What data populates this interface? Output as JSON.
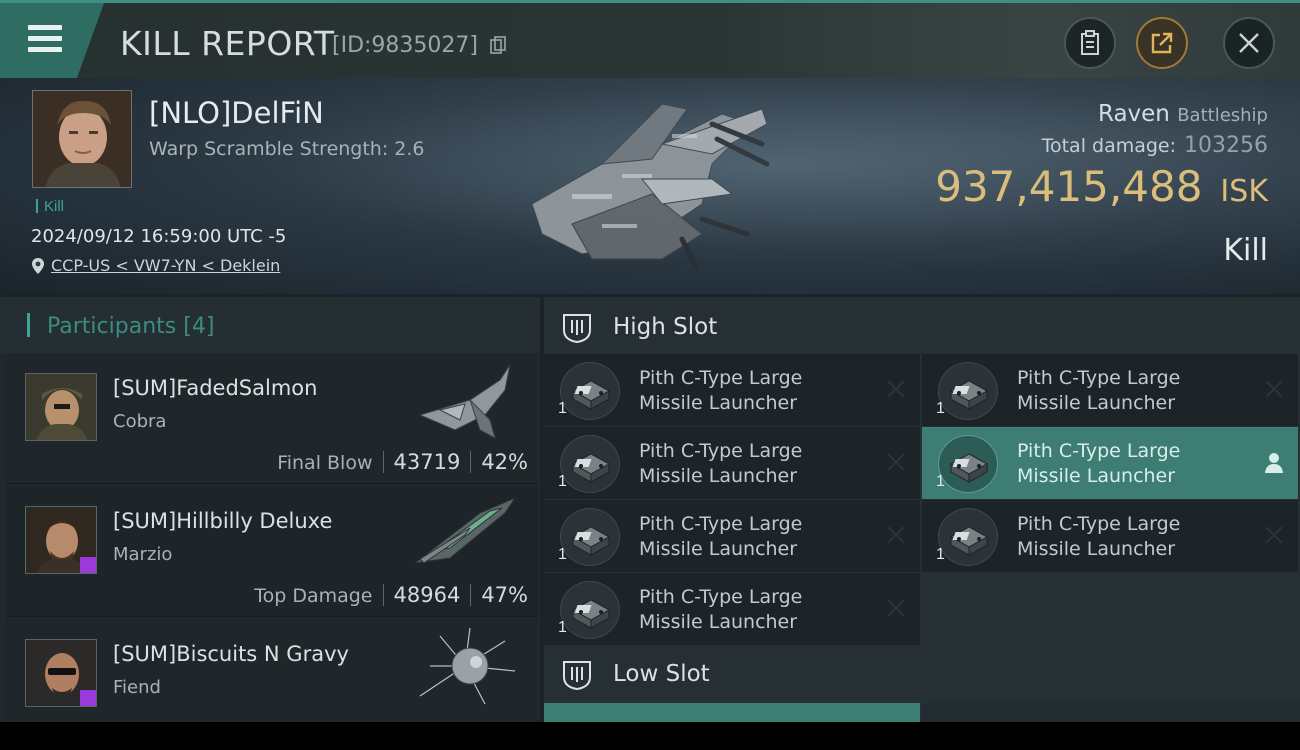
{
  "header": {
    "title": "KILL REPORT",
    "report_id": "[ID:9835027]",
    "accent": "#3f8f82"
  },
  "victim": {
    "name": "[NLO]DelFiN",
    "warp_scramble": "Warp Scramble Strength: 2.6",
    "kill_tag": "Kill",
    "datetime": "2024/09/12 16:59:00 UTC -5",
    "location": "CCP-US < VW7-YN < Deklein",
    "ship_name": "Raven",
    "ship_class": "Battleship",
    "total_damage_label": "Total damage:",
    "total_damage": "103256",
    "isk_value": "937,415,488",
    "isk_unit": "ISK",
    "result": "Kill"
  },
  "participants": {
    "title": "Participants",
    "count": "[4]",
    "items": [
      {
        "name": "[SUM]FadedSalmon",
        "ship": "Cobra",
        "stat_label": "Final Blow",
        "damage": "43719",
        "percent": "42%"
      },
      {
        "name": "[SUM]Hillbilly Deluxe",
        "ship": "Marzio",
        "stat_label": "Top Damage",
        "damage": "48964",
        "percent": "47%"
      },
      {
        "name": "[SUM]Biscuits N Gravy",
        "ship": "Fiend"
      }
    ]
  },
  "fitting": {
    "high_slot_title": "High Slot",
    "low_slot_title": "Low Slot",
    "module_line1": "Pith C-Type Large",
    "module_line2": "Missile Launcher",
    "qty": "1",
    "active_color": "#3d7d74"
  }
}
